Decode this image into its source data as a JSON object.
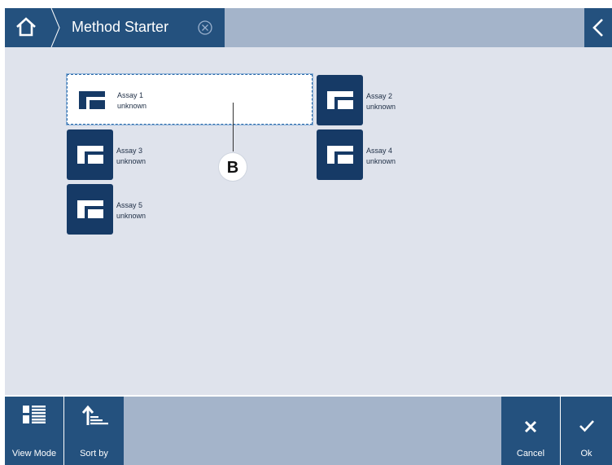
{
  "header": {
    "title": "Method Starter"
  },
  "assays": [
    {
      "name": "Assay 1",
      "status": "unknown"
    },
    {
      "name": "Assay 2",
      "status": "unknown"
    },
    {
      "name": "Assay 3",
      "status": "unknown"
    },
    {
      "name": "Assay 4",
      "status": "unknown"
    },
    {
      "name": "Assay 5",
      "status": "unknown"
    }
  ],
  "selected_assay": "Assay 1",
  "callout": {
    "label": "B"
  },
  "footer": {
    "view_mode_label": "View Mode",
    "sort_by_label": "Sort by",
    "cancel_label": "Cancel",
    "ok_label": "Ok"
  },
  "icons": {
    "home": "home-icon",
    "breadcrumb_close": "close-circle-icon",
    "back": "chevron-left-icon",
    "assay": "assay-method-icon",
    "view_mode": "view-mode-icon",
    "sort_by": "sort-icon",
    "cancel": "x-icon",
    "ok": "checkmark-icon"
  },
  "colors": {
    "primary": "#24517e",
    "tile": "#163a66",
    "header_bg": "#a4b4ca",
    "content_bg": "#dfe3ec"
  }
}
